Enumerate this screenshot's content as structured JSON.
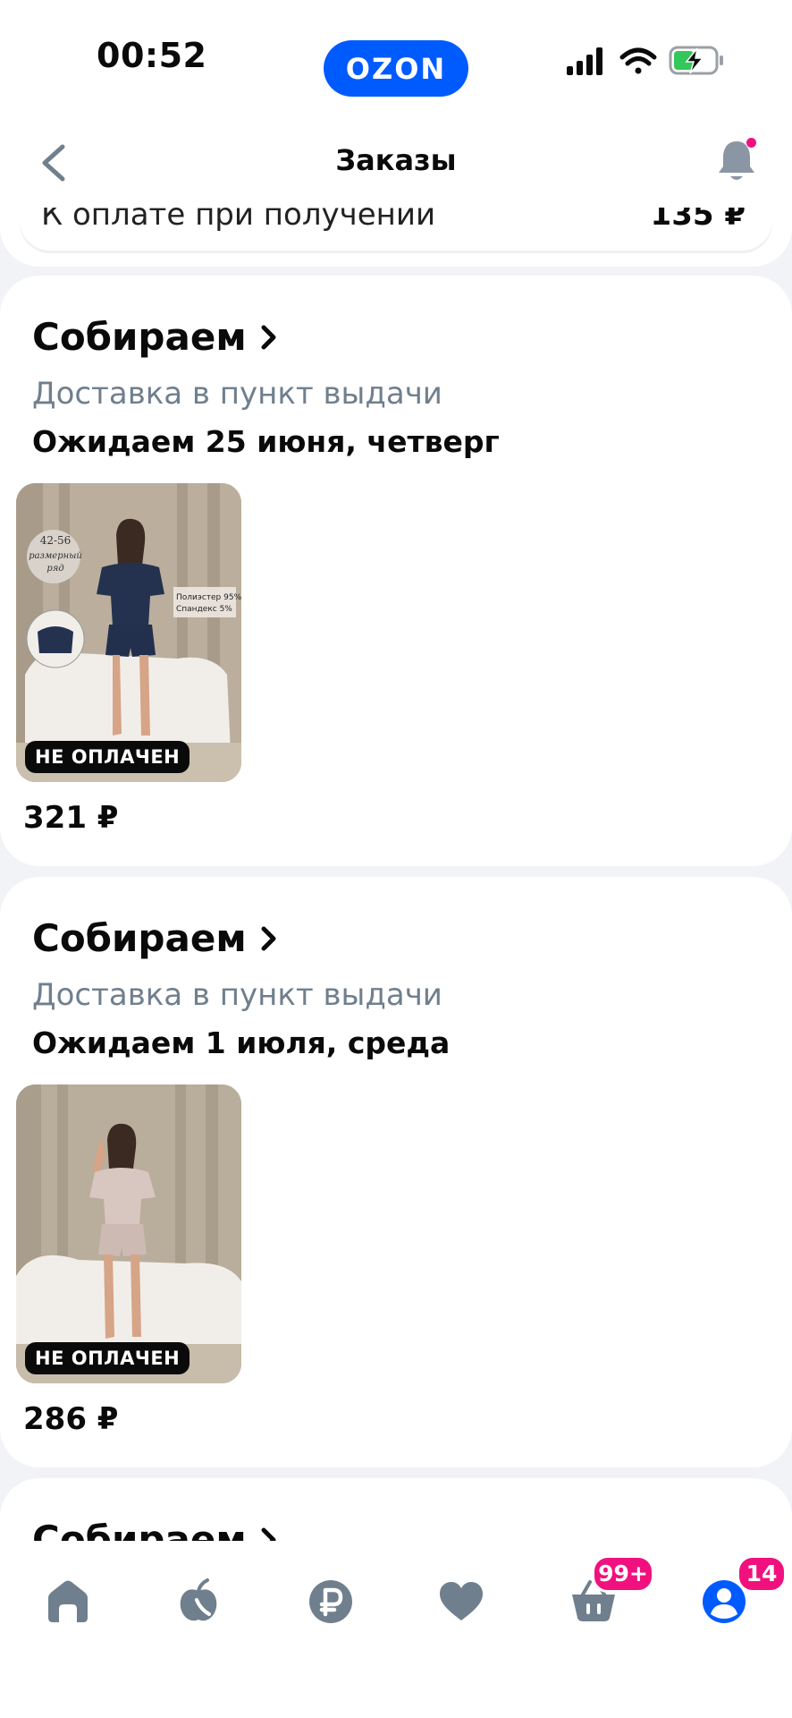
{
  "status_bar": {
    "time": "00:52",
    "logo": "OZON",
    "icons": [
      "signal-icon",
      "wifi-icon",
      "battery-charging-icon"
    ]
  },
  "header": {
    "title": "Заказы",
    "back_icon": "chevron-left-icon",
    "bell_icon": "bell-icon"
  },
  "previous_order": {
    "label": "К оплате при получении",
    "amount": "135 ₽"
  },
  "orders": [
    {
      "status": "Собираем",
      "delivery": "Доставка в пункт выдачи",
      "expected": "Ожидаем 25 июня, четверг",
      "badge": "НЕ ОПЛАЧЕН",
      "price": "321 ₽",
      "image_labels": [
        "42-56",
        "размерный",
        "ряд",
        "Полиэстер 95%",
        "Спандекс 5%"
      ]
    },
    {
      "status": "Собираем",
      "delivery": "Доставка в пункт выдачи",
      "expected": "Ожидаем 1 июля, среда",
      "badge": "НЕ ОПЛАЧЕН",
      "price": "286 ₽"
    },
    {
      "status": "Собираем"
    }
  ],
  "bottom_nav": [
    {
      "icon": "home-icon"
    },
    {
      "icon": "fresh-icon"
    },
    {
      "icon": "ruble-icon"
    },
    {
      "icon": "heart-icon"
    },
    {
      "icon": "cart-icon",
      "badge": "99+"
    },
    {
      "icon": "profile-icon",
      "badge": "14"
    }
  ],
  "colors": {
    "brand_blue": "#005BFF",
    "badge_pink": "#F1117E",
    "nav_inactive": "#707F8D"
  }
}
